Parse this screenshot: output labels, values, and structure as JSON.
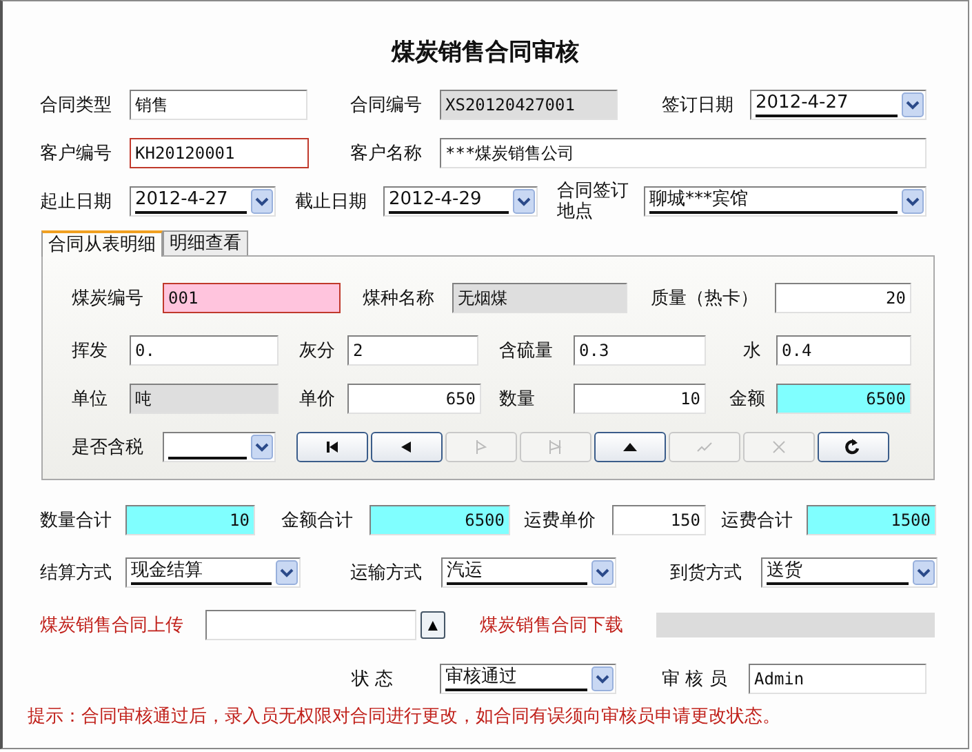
{
  "title": "煤炭销售合同审核",
  "header": [
    [
      {
        "label": "合同类型",
        "value": "销售",
        "kind": "text",
        "readonly": false,
        "required": false
      },
      {
        "label": "合同编号",
        "value": "XS20120427001",
        "kind": "text",
        "readonly": true,
        "required": false
      },
      {
        "label": "签订日期",
        "value": "2012-4-27",
        "kind": "combo",
        "readonly": false,
        "required": false
      }
    ],
    [
      {
        "label": "客户编号",
        "value": "KH20120001",
        "kind": "text",
        "readonly": false,
        "required": true
      },
      {
        "label": "客户名称",
        "value": "***煤炭销售公司",
        "kind": "text",
        "readonly": false,
        "required": false
      }
    ],
    [
      {
        "label": "起止日期",
        "value": "2012-4-27",
        "kind": "combo",
        "readonly": false,
        "required": false
      },
      {
        "label": "截止日期",
        "value": "2012-4-29",
        "kind": "combo",
        "readonly": false,
        "required": false
      },
      {
        "label": "合同签订地点",
        "value": "聊城***宾馆",
        "kind": "combo",
        "readonly": false,
        "required": false
      }
    ]
  ],
  "tabs": [
    {
      "label": "合同从表明细",
      "selected": true
    },
    {
      "label": "明细查看",
      "selected": false
    }
  ],
  "detail": [
    [
      {
        "label": "煤炭编号",
        "value": "001",
        "kind": "text",
        "readonly": false,
        "required": true,
        "color": "#ffc4dd"
      },
      {
        "label": "煤种名称",
        "value": "无烟煤",
        "kind": "text",
        "readonly": true,
        "required": false
      },
      {
        "label": "质量（热卡）",
        "value": "20",
        "kind": "number",
        "readonly": false,
        "required": false
      }
    ],
    [
      {
        "label": "挥发",
        "value": "0.",
        "kind": "text",
        "readonly": false,
        "required": false
      },
      {
        "label": "灰分",
        "value": "2",
        "kind": "text",
        "readonly": false,
        "required": false
      },
      {
        "label": "含硫量",
        "value": "0.3",
        "kind": "text",
        "readonly": false,
        "required": false
      },
      {
        "label": "水",
        "value": "0.4",
        "kind": "text",
        "readonly": false,
        "required": false
      }
    ],
    [
      {
        "label": "单位",
        "value": "吨",
        "kind": "text",
        "readonly": true,
        "required": false
      },
      {
        "label": "单价",
        "value": "650",
        "kind": "number",
        "readonly": false,
        "required": false
      },
      {
        "label": "数量",
        "value": "10",
        "kind": "number",
        "readonly": false,
        "required": false
      },
      {
        "label": "金额",
        "value": "6500",
        "kind": "number",
        "readonly": false,
        "required": false,
        "color": "#80ffff"
      }
    ],
    [
      {
        "label": "是否含税",
        "kind": "combo",
        "readonly": false,
        "required": false
      }
    ]
  ],
  "nav_buttons": [
    {
      "kind": "first",
      "disabled": false
    },
    {
      "kind": "prev",
      "disabled": false
    },
    {
      "kind": "next",
      "disabled": true
    },
    {
      "kind": "last",
      "disabled": true
    },
    {
      "kind": "up",
      "disabled": false
    },
    {
      "kind": "save",
      "disabled": true
    },
    {
      "kind": "cancel",
      "disabled": true
    },
    {
      "kind": "refresh",
      "disabled": false
    }
  ],
  "footer": [
    [
      {
        "label": "数量合计",
        "value": "10",
        "kind": "number",
        "readonly": false,
        "required": false,
        "color": "#80ffff"
      },
      {
        "label": "金额合计",
        "value": "6500",
        "kind": "number",
        "readonly": false,
        "required": false,
        "color": "#80ffff"
      },
      {
        "label": "运费单价",
        "value": "150",
        "kind": "number",
        "readonly": false,
        "required": false
      },
      {
        "label": "运费合计",
        "value": "1500",
        "kind": "number",
        "readonly": false,
        "required": false,
        "color": "#80ffff"
      }
    ],
    [
      {
        "label": "结算方式",
        "value": "现金结算",
        "kind": "combo",
        "readonly": false,
        "required": false
      },
      {
        "label": "运输方式",
        "value": "汽运",
        "kind": "combo",
        "readonly": false,
        "required": false
      },
      {
        "label": "到货方式",
        "value": "送货",
        "kind": "combo",
        "readonly": false,
        "required": false
      }
    ]
  ],
  "upload": {
    "upload_label": "煤炭销售合同上传",
    "upload_button": "▲",
    "download_label": "煤炭销售合同下载"
  },
  "review": [
    {
      "label": "状 态",
      "value": "审核通过",
      "kind": "combo",
      "readonly": false,
      "required": false
    },
    {
      "label": "审 核 员",
      "value": "Admin",
      "kind": "text",
      "readonly": false,
      "required": false
    }
  ],
  "note": "提示：合同审核通过后，录入员无权限对合同进行更改，如合同有误须向审核员申请更改状态。"
}
